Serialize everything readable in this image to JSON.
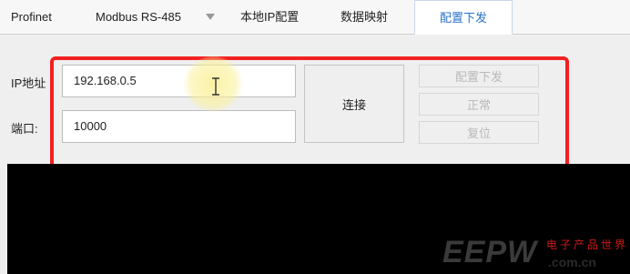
{
  "tabs": [
    {
      "label": "Profinet"
    },
    {
      "label": "Modbus RS-485"
    },
    {
      "label": "本地IP配置"
    },
    {
      "label": "数据映射"
    },
    {
      "label": "配置下发",
      "active": true
    }
  ],
  "form": {
    "ip_label": "IP地址",
    "ip_value": "192.168.0.5",
    "port_label": "端口:",
    "port_value": "10000"
  },
  "buttons": {
    "connect": "连接",
    "config_send": "配置下发",
    "normal": "正常",
    "reset": "复位"
  },
  "watermark": {
    "logo": "EEPW",
    "cn_text": "电子产品世界",
    "url": ".com.cn"
  },
  "colors": {
    "active_tab": "#2a73c9",
    "highlight": "#f22020",
    "console_bg": "#000000"
  }
}
